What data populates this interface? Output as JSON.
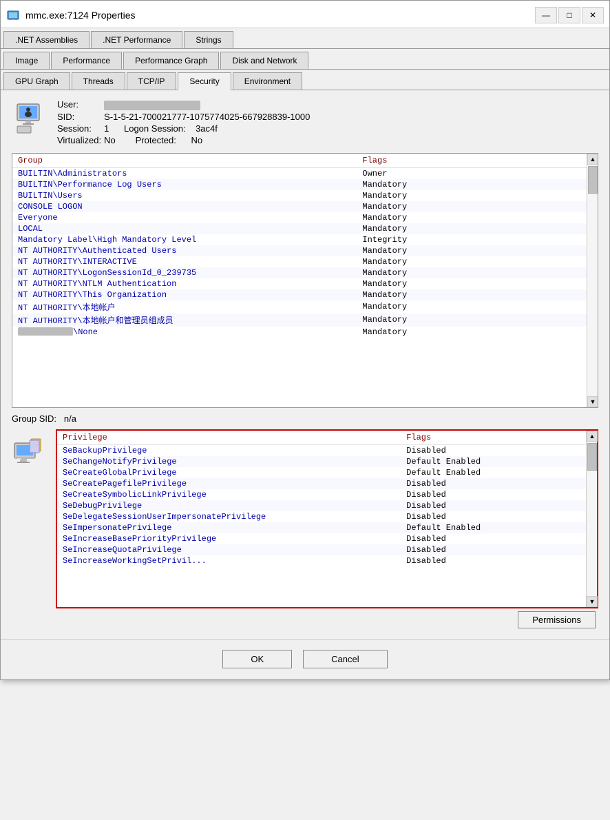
{
  "window": {
    "title": "mmc.exe:7124 Properties",
    "icon": "computer-icon"
  },
  "titlebar_buttons": {
    "minimize": "—",
    "maximize": "□",
    "close": "✕"
  },
  "tabs_row1": [
    {
      "id": "net-assemblies",
      "label": ".NET Assemblies",
      "active": false
    },
    {
      "id": "net-performance",
      "label": ".NET Performance",
      "active": false
    },
    {
      "id": "strings",
      "label": "Strings",
      "active": false
    }
  ],
  "tabs_row2": [
    {
      "id": "image",
      "label": "Image",
      "active": false
    },
    {
      "id": "performance",
      "label": "Performance",
      "active": false
    },
    {
      "id": "performance-graph",
      "label": "Performance Graph",
      "active": false
    },
    {
      "id": "disk-and-network",
      "label": "Disk and Network",
      "active": false
    }
  ],
  "tabs_row3": [
    {
      "id": "gpu-graph",
      "label": "GPU Graph",
      "active": false
    },
    {
      "id": "threads",
      "label": "Threads",
      "active": false
    },
    {
      "id": "tcp-ip",
      "label": "TCP/IP",
      "active": false
    },
    {
      "id": "security",
      "label": "Security",
      "active": true
    },
    {
      "id": "environment",
      "label": "Environment",
      "active": false
    }
  ],
  "user_info": {
    "user_label": "User:",
    "user_value_blurred": true,
    "sid_label": "SID:",
    "sid_value": "S-1-5-21-700021777-1075774025-667928839-1000",
    "session_label": "Session:",
    "session_value": "1",
    "logon_session_label": "Logon Session:",
    "logon_session_value": "3ac4f",
    "virtualized_label": "Virtualized:",
    "virtualized_value": "No",
    "protected_label": "Protected:",
    "protected_value": "No"
  },
  "group_table": {
    "col_group": "Group",
    "col_flags": "Flags",
    "rows": [
      {
        "group": "BUILTIN\\Administrators",
        "flags": "Owner",
        "group_color": "blue",
        "flags_color": "black"
      },
      {
        "group": "BUILTIN\\Performance Log Users",
        "flags": "Mandatory",
        "group_color": "blue",
        "flags_color": "black"
      },
      {
        "group": "BUILTIN\\Users",
        "flags": "Mandatory",
        "group_color": "blue",
        "flags_color": "black"
      },
      {
        "group": "CONSOLE LOGON",
        "flags": "Mandatory",
        "group_color": "blue",
        "flags_color": "black"
      },
      {
        "group": "Everyone",
        "flags": "Mandatory",
        "group_color": "blue",
        "flags_color": "black"
      },
      {
        "group": "LOCAL",
        "flags": "Mandatory",
        "group_color": "blue",
        "flags_color": "black"
      },
      {
        "group": "Mandatory Label\\High Mandatory Level",
        "flags": "Integrity",
        "group_color": "blue",
        "flags_color": "black"
      },
      {
        "group": "NT AUTHORITY\\Authenticated Users",
        "flags": "Mandatory",
        "group_color": "blue",
        "flags_color": "black"
      },
      {
        "group": "NT AUTHORITY\\INTERACTIVE",
        "flags": "Mandatory",
        "group_color": "blue",
        "flags_color": "black"
      },
      {
        "group": "NT AUTHORITY\\LogonSessionId_0_239735",
        "flags": "Mandatory",
        "group_color": "blue",
        "flags_color": "black"
      },
      {
        "group": "NT AUTHORITY\\NTLM Authentication",
        "flags": "Mandatory",
        "group_color": "blue",
        "flags_color": "black"
      },
      {
        "group": "NT AUTHORITY\\This Organization",
        "flags": "Mandatory",
        "group_color": "blue",
        "flags_color": "black"
      },
      {
        "group": "NT AUTHORITY\\本地帐户",
        "flags": "Mandatory",
        "group_color": "blue",
        "flags_color": "black"
      },
      {
        "group": "NT AUTHORITY\\本地帐户和管理员组成员",
        "flags": "Mandatory",
        "group_color": "blue",
        "flags_color": "black"
      },
      {
        "group": "████████████\\None",
        "flags": "Mandatory",
        "group_color": "blue",
        "flags_color": "black"
      }
    ]
  },
  "group_sid": {
    "label": "Group SID:",
    "value": "n/a"
  },
  "privilege_table": {
    "col_privilege": "Privilege",
    "col_flags": "Flags",
    "rows": [
      {
        "privilege": "SeBackupPrivilege",
        "flags": "Disabled"
      },
      {
        "privilege": "SeChangeNotifyPrivilege",
        "flags": "Default Enabled"
      },
      {
        "privilege": "SeCreateGlobalPrivilege",
        "flags": "Default Enabled"
      },
      {
        "privilege": "SeCreatePagefilePrivilege",
        "flags": "Disabled"
      },
      {
        "privilege": "SeCreateSymbolicLinkPrivilege",
        "flags": "Disabled"
      },
      {
        "privilege": "SeDebugPrivilege",
        "flags": "Disabled"
      },
      {
        "privilege": "SeDelegateSessionUserImpersonatePrivilege",
        "flags": "Disabled"
      },
      {
        "privilege": "SeImpersonatePrivilege",
        "flags": "Default Enabled"
      },
      {
        "privilege": "SeIncreaseBasePriorityPrivilege",
        "flags": "Disabled"
      },
      {
        "privilege": "SeIncreaseQuotaPrivilege",
        "flags": "Disabled"
      },
      {
        "privilege": "SeIncreaseWorkingSetPrivil...",
        "flags": "Disabled"
      }
    ]
  },
  "buttons": {
    "permissions": "Permissions",
    "ok": "OK",
    "cancel": "Cancel"
  }
}
